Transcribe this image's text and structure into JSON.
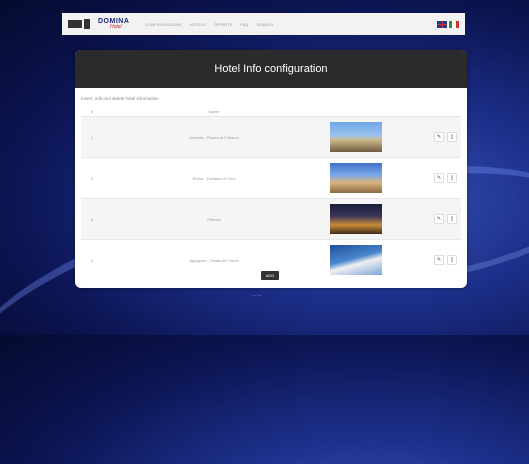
{
  "topbar": {
    "logo_main": "DOMINA",
    "logo_sub": "Hotel",
    "nav": [
      "CONFIGURAZIONE",
      "HOTELS",
      "OFFERTE",
      "FAQ",
      "SEARCH"
    ],
    "flags": [
      "uk-flag",
      "italy-flag"
    ]
  },
  "panel": {
    "title": "Hotel Info configuration",
    "description": "Insert, edit and delete hotel information",
    "columns": [
      "#",
      "Name",
      "",
      ""
    ],
    "rows": [
      {
        "num": "1",
        "name": "Venezia - Piazza di S.Marco",
        "image": "venice"
      },
      {
        "num": "2",
        "name": "Roma - Fontana di Trevi",
        "image": "rome"
      },
      {
        "num": "3",
        "name": "Firenze",
        "image": "florence"
      },
      {
        "num": "4",
        "name": "Agrigento - Scala dei Turchi",
        "image": "agrigento"
      }
    ],
    "edit_icon": "✎",
    "delete_icon": "🗑",
    "add_label": "ADD"
  },
  "footer": "— —",
  "colors": {
    "header_bg": "#2b2b2b",
    "page_bg": "#0b1450",
    "flag_it": [
      "#2e8b3d",
      "#ffffff",
      "#d32f2f"
    ]
  }
}
